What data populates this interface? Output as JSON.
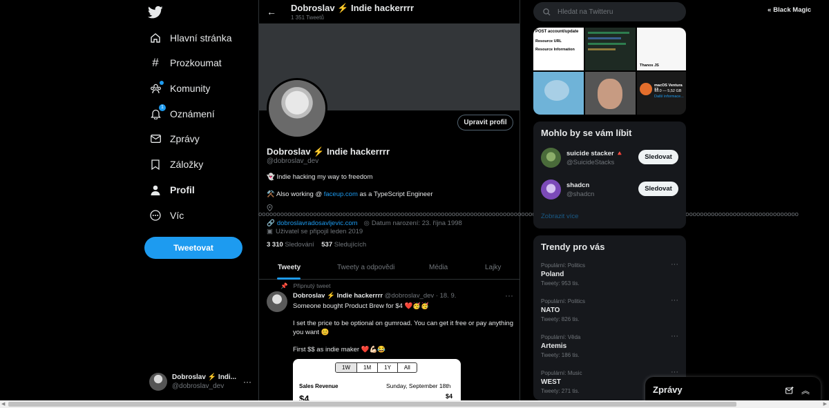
{
  "nav": {
    "items": [
      {
        "label": "Hlavní stránka",
        "icon": "home-icon"
      },
      {
        "label": "Prozkoumat",
        "icon": "hashtag-icon"
      },
      {
        "label": "Komunity",
        "icon": "communities-icon"
      },
      {
        "label": "Oznámení",
        "icon": "bell-icon",
        "badge": "1"
      },
      {
        "label": "Zprávy",
        "icon": "envelope-icon"
      },
      {
        "label": "Záložky",
        "icon": "bookmark-icon"
      },
      {
        "label": "Profil",
        "icon": "person-icon"
      },
      {
        "label": "Víc",
        "icon": "more-circle-icon"
      }
    ],
    "tweet_button": "Tweetovat",
    "account": {
      "name": "Dobroslav ⚡ Indi...",
      "handle": "@dobroslav_dev",
      "more": "···"
    }
  },
  "profile": {
    "header_name": "Dobroslav ⚡ Indie hackerrrr",
    "tweet_count": "1 351 Tweetů",
    "edit_button": "Upravit profil",
    "name": "Dobroslav ⚡ Indie hackerrrr",
    "handle": "@dobroslav_dev",
    "bio_line1": "Indie hacking my way to freedom",
    "bio_line2_pre": "Also working @ ",
    "bio_line2_link": "faceup.com",
    "bio_line2_post": " as a TypeScript Engineer",
    "location": "oooooooooooooooooooooooooooooooooooooooooooooooooooooooooooooooooooooooooooooooooooooooooooooooooooooooooooooooooooooooooooooooooooooooooooooooooooo",
    "website": "dobroslavradosavljevic.com",
    "birthday": "Datum narození: 23. října 1998",
    "joined": "Uživatel se připojil leden 2019",
    "following_count": "3 310",
    "following_label": "Sledování",
    "followers_count": "537",
    "followers_label": "Sledujících",
    "tabs": [
      "Tweety",
      "Tweety a odpovědi",
      "Média",
      "Lajky"
    ]
  },
  "tweet": {
    "pinned_label": "Připnutý tweet",
    "author": "Dobroslav ⚡ Indie hackerrrr",
    "handle_time": "@dobroslav_dev · 18. 9.",
    "line1": "Someone bought Product Brew for $4 ❤️🥳🥳",
    "line2": "I set the price to be optional on gumroad. You can get it free or pay anything you want 😊",
    "line3": "First $$ as indie maker ❤️💪🏻😂",
    "card": {
      "ranges": [
        "1W",
        "1M",
        "1Y",
        "All"
      ],
      "active_range": "1W",
      "label": "Sales Revenue",
      "date": "Sunday, September 18th",
      "amount": "$4",
      "big": "$4"
    }
  },
  "right": {
    "search_placeholder": "Hledat na Twitteru",
    "extension": "Black Magic",
    "media_texts": {
      "t1": "POST account/update",
      "t1b": "Resource URL",
      "t1c": "Resource Information",
      "t3": "Thanos JS",
      "t6": "macOS Ventura 13",
      "t6b": "13.0 — 5,52 GB",
      "t6c": "Další informace..."
    },
    "suggest_title": "Mohlo by se vám líbit",
    "suggestions": [
      {
        "name": "suicide stacker 🔺",
        "handle": "@SuicideStacks",
        "button": "Sledovat"
      },
      {
        "name": "shadcn",
        "handle": "@shadcn",
        "button": "Sledovat"
      }
    ],
    "show_more": "Zobrazit více",
    "trends_title": "Trendy pro vás",
    "trends": [
      {
        "category": "Populární: Politics",
        "title": "Poland",
        "count": "Tweety: 953 tis."
      },
      {
        "category": "Populární: Politics",
        "title": "NATO",
        "count": "Tweety: 826 tis."
      },
      {
        "category": "Populární: Věda",
        "title": "Artemis",
        "count": "Tweety: 186 tis."
      },
      {
        "category": "Populární: Music",
        "title": "WEST",
        "count": "Tweety: 271 tis."
      }
    ],
    "messages_dock": "Zprávy"
  },
  "colors": {
    "accent": "#1d9bf0",
    "background": "#000000",
    "panel": "#16181c",
    "muted": "#71767b"
  }
}
